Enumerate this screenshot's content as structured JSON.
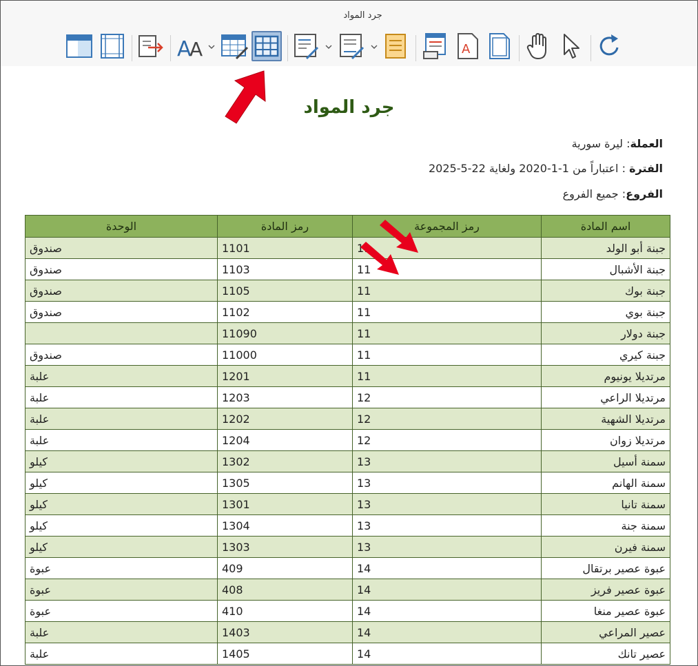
{
  "window": {
    "title": "جرد المواد"
  },
  "toolbar": {
    "icons": [
      {
        "name": "page-layout-icon"
      },
      {
        "name": "margins-icon"
      },
      {
        "name": "export-icon"
      },
      {
        "name": "font-icon"
      },
      {
        "name": "table-style-icon"
      },
      {
        "name": "grid-lines-icon"
      },
      {
        "name": "edit-header-icon"
      },
      {
        "name": "edit-footer-icon"
      },
      {
        "name": "page-color-icon"
      },
      {
        "name": "print-preview-icon"
      },
      {
        "name": "pdf-icon"
      },
      {
        "name": "page-icon"
      },
      {
        "name": "hand-tool-icon"
      },
      {
        "name": "pointer-tool-icon"
      },
      {
        "name": "refresh-icon"
      }
    ],
    "active_icon": "grid-lines-icon"
  },
  "report": {
    "title": "جرد المواد",
    "currency_label": "العملة",
    "currency_value": "ليرة سورية",
    "period_label": "الفترة",
    "period_value": "اعتباراً من 1-1-2020 ولغاية 22-5-2025",
    "branches_label": "الفروع",
    "branches_value": "جميع الفروع"
  },
  "table": {
    "headers": [
      "اسم المادة",
      "رمز المجموعة",
      "رمز المادة",
      "الوحدة"
    ],
    "rows": [
      [
        "جبنة أبو الولد",
        "11",
        "1101",
        "صندوق"
      ],
      [
        "جبنة الأشبال",
        "11",
        "1103",
        "صندوق"
      ],
      [
        "جبنة بوك",
        "11",
        "1105",
        "صندوق"
      ],
      [
        "جبنة بوي",
        "11",
        "1102",
        "صندوق"
      ],
      [
        "جبنة دولار",
        "11",
        "11090",
        ""
      ],
      [
        "جبنة كيري",
        "11",
        "11000",
        "صندوق"
      ],
      [
        "مرتديلا يونيوم",
        "11",
        "1201",
        "علبة"
      ],
      [
        "مرتديلا الراعي",
        "12",
        "1203",
        "علبة"
      ],
      [
        "مرتديلا الشهية",
        "12",
        "1202",
        "علبة"
      ],
      [
        "مرتديلا زوان",
        "12",
        "1204",
        "علبة"
      ],
      [
        "سمنة أسيل",
        "13",
        "1302",
        "كيلو"
      ],
      [
        "سمنة الهانم",
        "13",
        "1305",
        "كيلو"
      ],
      [
        "سمنة تانيا",
        "13",
        "1301",
        "كيلو"
      ],
      [
        "سمنة جنة",
        "13",
        "1304",
        "كيلو"
      ],
      [
        "سمنة فيرن",
        "13",
        "1303",
        "كيلو"
      ],
      [
        "عبوة عصير برتقال",
        "14",
        "409",
        "عبوة"
      ],
      [
        "عبوة عصير فريز",
        "14",
        "408",
        "عبوة"
      ],
      [
        "عبوة عصير منغا",
        "14",
        "410",
        "عبوة"
      ],
      [
        "عصير المراعي",
        "14",
        "1403",
        "علبة"
      ],
      [
        "عصير تانك",
        "14",
        "1405",
        "علبة"
      ]
    ]
  },
  "colors": {
    "header_bg": "#8db25c",
    "row_alt": "#dfe9cb",
    "title": "#2e5a14",
    "arrow": "#e8001c"
  }
}
